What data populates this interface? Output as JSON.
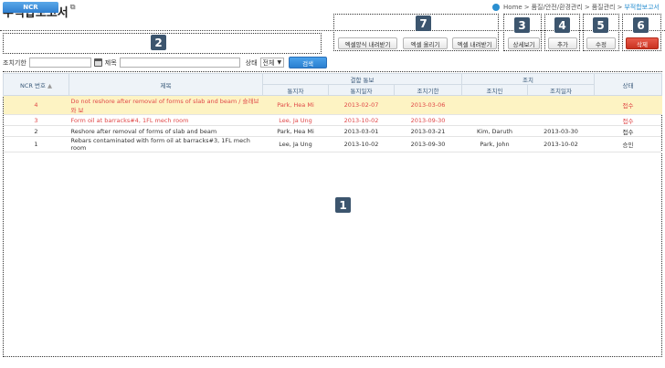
{
  "header": {
    "title": "부적합보고서",
    "breadcrumb": [
      "Home",
      "품질/안전/환경관리",
      "품질관리",
      "부적합보고서"
    ],
    "breadcrumb_sep": ">"
  },
  "tab": {
    "label": "NCR"
  },
  "callouts": [
    "1",
    "2",
    "3",
    "4",
    "5",
    "6",
    "7"
  ],
  "buttons": {
    "excel_template_download": "엑셀양식 내려받기",
    "excel_upload": "엑셀 올리기",
    "excel_download": "엑셀 내려받기",
    "detail": "상세보기",
    "add": "추가",
    "edit": "수정",
    "delete": "삭제",
    "search": "검색"
  },
  "filters": {
    "due_label": "조치기한",
    "due_value": "",
    "title_label": "제목",
    "title_value": "",
    "status_label": "상태",
    "status_selected": "전체"
  },
  "table": {
    "headers": {
      "no": "NCR 번호",
      "sort_indicator": "▲",
      "title": "제목",
      "defect_notice": "결함 통보",
      "notifier": "통지자",
      "notice_date": "통지일자",
      "due_date": "조치기한",
      "action": "조치",
      "action_person": "조치인",
      "action_date": "조치일자",
      "status": "상태"
    },
    "rows": [
      {
        "no": "4",
        "title": "Do not reshore after removal of forms of slab and beam / 슬래브와 보",
        "notifier": "Park, Hea Mi",
        "notice_date": "2013-02-07",
        "due_date": "2013-03-06",
        "action_person": "",
        "action_date": "",
        "status": "접수"
      },
      {
        "no": "3",
        "title": "Form oil at barracks#4, 1FL mech room",
        "notifier": "Lee, Ja Ung",
        "notice_date": "2013-10-02",
        "due_date": "2013-09-30",
        "action_person": "",
        "action_date": "",
        "status": "접수"
      },
      {
        "no": "2",
        "title": "Reshore after removal of forms of slab and beam",
        "notifier": "Park, Hea Mi",
        "notice_date": "2013-03-01",
        "due_date": "2013-03-21",
        "action_person": "Kim, Daruth",
        "action_date": "2013-03-30",
        "status": "접수"
      },
      {
        "no": "1",
        "title": "Rebars contaminated with form oil at barracks#3, 1FL mech room",
        "notifier": "Lee, Ja Ung",
        "notice_date": "2013-10-02",
        "due_date": "2013-09-30",
        "action_person": "Park, John",
        "action_date": "2013-10-02",
        "status": "승인"
      }
    ]
  },
  "colors": {
    "accent": "#2a8fd0",
    "callout": "#3c556e",
    "delete": "#d2402f",
    "highlight_row": "#fdf3c3",
    "overdue_text": "#e04848"
  }
}
